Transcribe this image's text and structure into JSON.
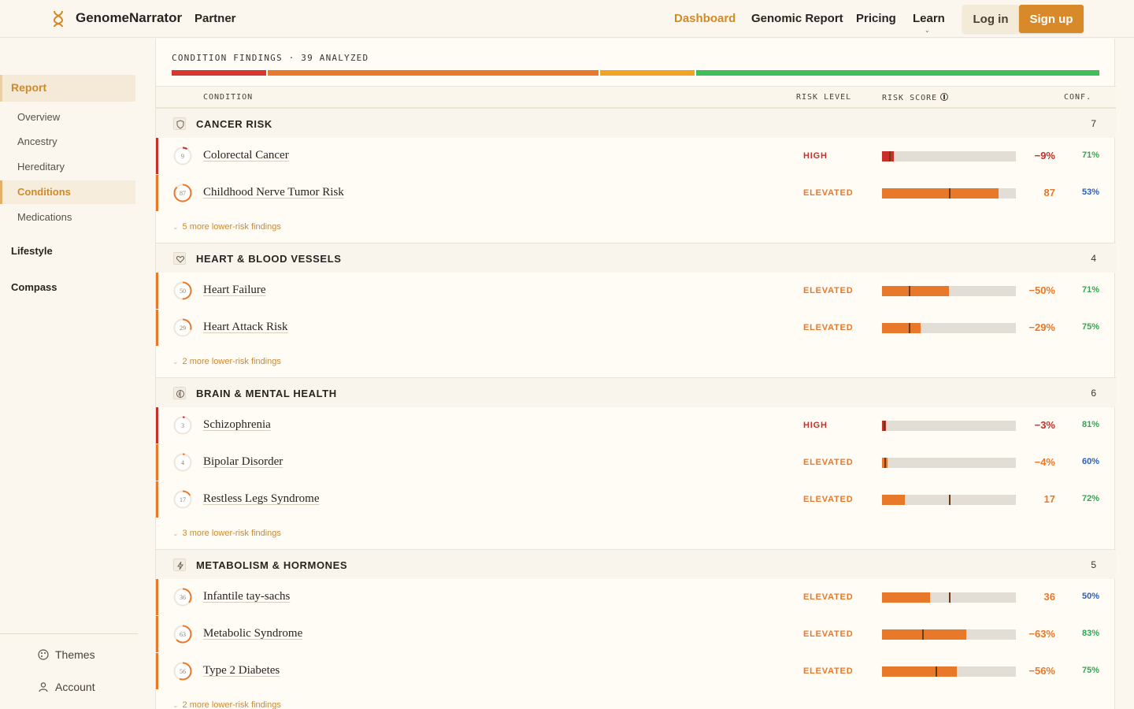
{
  "nav": {
    "brand": "GenomeNarrator",
    "partner": "Partner",
    "links": [
      "Dashboard",
      "Genomic Report",
      "Pricing",
      "Learn"
    ],
    "login": "Log in",
    "signup": "Sign up"
  },
  "sidebar": {
    "report": "Report",
    "items": [
      "Overview",
      "Ancestry",
      "Hereditary",
      "Conditions",
      "Medications"
    ],
    "sections": [
      "Lifestyle",
      "Compass"
    ],
    "themes": "Themes",
    "account": "Account"
  },
  "findings": {
    "title": "CONDITION FINDINGS · 39 ANALYZED",
    "distribution_colors": [
      "#d6372e",
      "#e8782a",
      "#f0a325",
      "#3fbf5a"
    ]
  },
  "columns": {
    "condition": "CONDITION",
    "risk_level": "RISK LEVEL",
    "risk_score": "RISK SCORE",
    "conf": "CONF."
  },
  "categories": [
    {
      "label": "CANCER RISK",
      "count": "7",
      "icon": "shield-icon",
      "rows": [
        {
          "badge": "9",
          "name": "Colorectal Cancer",
          "level": "HIGH",
          "score": "−9%",
          "conf": "71%",
          "fill": 0.09,
          "marker": 0.05
        },
        {
          "badge": "87",
          "name": "Childhood Nerve Tumor Risk",
          "level": "ELEVATED",
          "score": "87",
          "conf": "53%",
          "fill": 0.87,
          "marker": 0.5
        }
      ],
      "more": "5 more lower-risk findings"
    },
    {
      "label": "HEART & BLOOD VESSELS",
      "count": "4",
      "icon": "heart-icon",
      "rows": [
        {
          "badge": "50",
          "name": "Heart Failure",
          "level": "ELEVATED",
          "score": "−50%",
          "conf": "71%",
          "fill": 0.5,
          "marker": 0.2
        },
        {
          "badge": "29",
          "name": "Heart Attack Risk",
          "level": "ELEVATED",
          "score": "−29%",
          "conf": "75%",
          "fill": 0.29,
          "marker": 0.2
        }
      ],
      "more": "2 more lower-risk findings"
    },
    {
      "label": "BRAIN & MENTAL HEALTH",
      "count": "6",
      "icon": "brain-icon",
      "rows": [
        {
          "badge": "3",
          "name": "Schizophrenia",
          "level": "HIGH",
          "score": "−3%",
          "conf": "81%",
          "fill": 0.03,
          "marker": 0.01
        },
        {
          "badge": "4",
          "name": "Bipolar Disorder",
          "level": "ELEVATED",
          "score": "−4%",
          "conf": "60%",
          "fill": 0.04,
          "marker": 0.02
        },
        {
          "badge": "17",
          "name": "Restless Legs Syndrome",
          "level": "ELEVATED",
          "score": "17",
          "conf": "72%",
          "fill": 0.17,
          "marker": 0.5
        }
      ],
      "more": "3 more lower-risk findings"
    },
    {
      "label": "METABOLISM & HORMONES",
      "count": "5",
      "icon": "bolt-icon",
      "rows": [
        {
          "badge": "36",
          "name": "Infantile tay-sachs",
          "level": "ELEVATED",
          "score": "36",
          "conf": "50%",
          "fill": 0.36,
          "marker": 0.5
        },
        {
          "badge": "63",
          "name": "Metabolic Syndrome",
          "level": "ELEVATED",
          "score": "−63%",
          "conf": "83%",
          "fill": 0.63,
          "marker": 0.3
        },
        {
          "badge": "56",
          "name": "Type 2 Diabetes",
          "level": "ELEVATED",
          "score": "−56%",
          "conf": "75%",
          "fill": 0.56,
          "marker": 0.4
        }
      ],
      "more": "2 more lower-risk findings"
    }
  ],
  "colors": {
    "high": "#c8302b",
    "elevated": "#e8782a",
    "conf_green": "#2fa84f",
    "conf_blue": "#2c5fb8",
    "accent_gold": "#d18a25"
  }
}
